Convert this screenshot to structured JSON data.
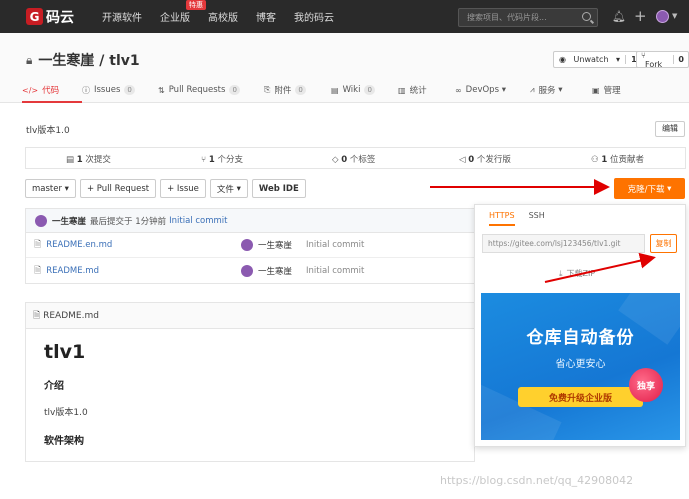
{
  "topnav": {
    "logo_text": "码云",
    "links": [
      "开源软件",
      "企业版",
      "高校版",
      "博客",
      "我的码云"
    ],
    "special_badge": "特惠",
    "search_placeholder": "搜索项目、代码片段..."
  },
  "project": {
    "title": "一生寒崖 / tlv1",
    "watch_label": "Unwatch",
    "watch_count": "1",
    "fork_label": "Fork",
    "fork_count": "0",
    "tabs": [
      {
        "label": "代码",
        "count": "",
        "icon": "code-icon"
      },
      {
        "label": "Issues",
        "count": "0",
        "icon": "issues-icon"
      },
      {
        "label": "Pull Requests",
        "count": "0",
        "icon": "pull-request-icon"
      },
      {
        "label": "附件",
        "count": "0",
        "icon": "attachment-icon"
      },
      {
        "label": "Wiki",
        "count": "0",
        "icon": "wiki-icon"
      },
      {
        "label": "统计",
        "count": "",
        "icon": "stats-icon"
      },
      {
        "label": "DevOps",
        "count": "",
        "icon": "devops-icon"
      },
      {
        "label": "服务",
        "count": "",
        "icon": "service-icon"
      },
      {
        "label": "管理",
        "count": "",
        "icon": "manage-icon"
      }
    ]
  },
  "main": {
    "description": "tlv版本1.0",
    "edit_label": "编辑",
    "stats": {
      "commits_num": "1",
      "commits_text": "次提交",
      "branches_num": "1",
      "branches_text": "个分支",
      "tags_num": "0",
      "tags_text": "个标签",
      "releases_num": "0",
      "releases_text": "个发行版",
      "contributors_num": "1",
      "contributors_text": "位贡献者"
    },
    "toolbar": {
      "branch": "master",
      "pull_request": "+ Pull Request",
      "issue": "+ Issue",
      "file": "文件",
      "webide": "Web IDE",
      "clone": "克隆/下载"
    },
    "last_commit": {
      "author": "一生寒崖",
      "text": "最后提交于",
      "time": "1分钟前",
      "message": "Initial commit"
    },
    "files": [
      {
        "name": "README.en.md",
        "author": "一生寒崖",
        "message": "Initial commit"
      },
      {
        "name": "README.md",
        "author": "一生寒崖",
        "message": "Initial commit"
      }
    ],
    "readme": {
      "filename": "README.md",
      "h1": "tlv1",
      "h2_intro": "介绍",
      "intro_text": "tlv版本1.0",
      "h2_arch": "软件架构"
    }
  },
  "clone_panel": {
    "tab_https": "HTTPS",
    "tab_ssh": "SSH",
    "url": "https://gitee.com/lsj123456/tlv1.git",
    "copy_label": "复制",
    "download_label": "下载ZIP",
    "banner_title": "仓库自动备份",
    "banner_sub": "省心更安心",
    "banner_button": "免费升级企业版",
    "banner_badge": "独享"
  },
  "watermark": "https://blog.csdn.net/qq_42908042",
  "colors": {
    "accent": "#fe7300",
    "brand_red": "#c71d23",
    "link": "#3a6fb7",
    "annotation_red": "#e00000"
  }
}
